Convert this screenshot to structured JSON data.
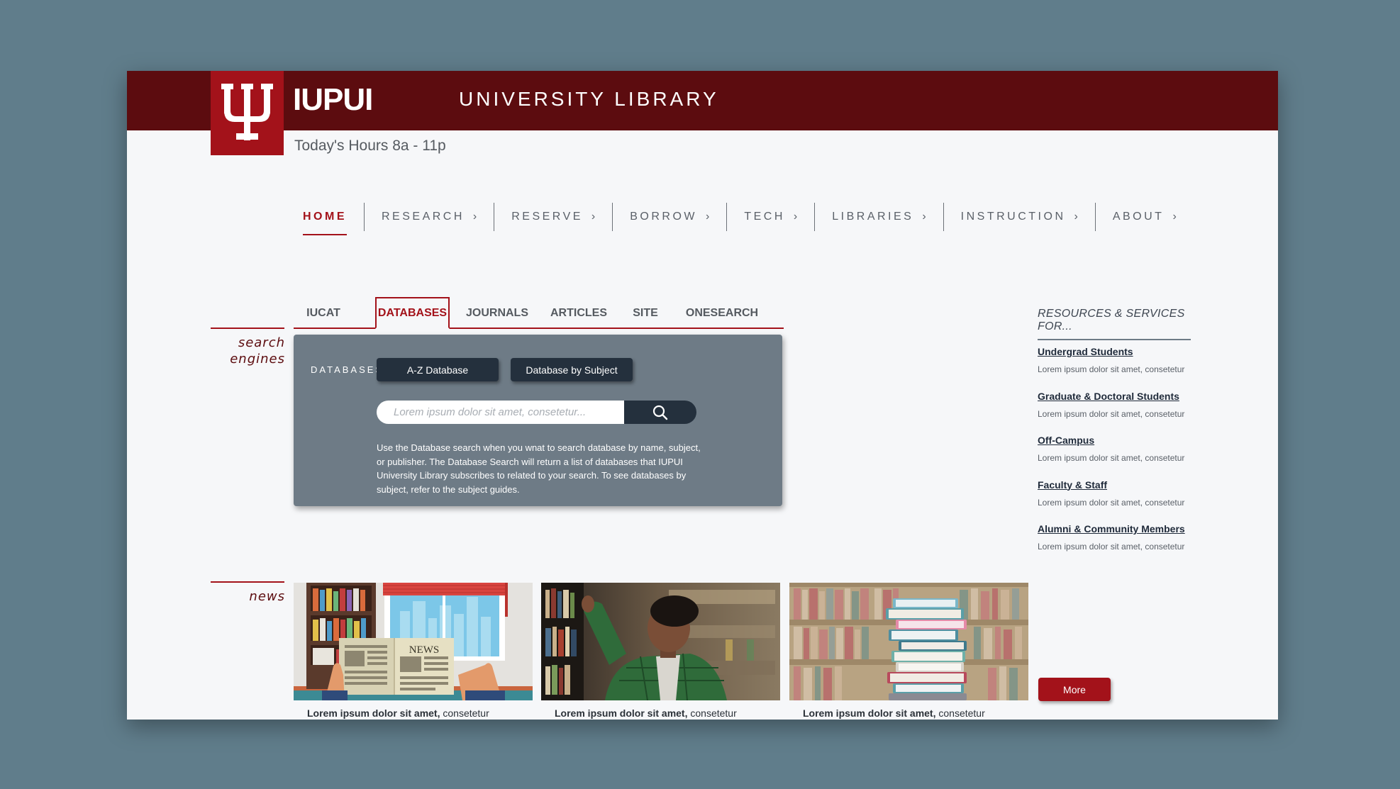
{
  "header": {
    "brand": "IUPUI",
    "unit_title": "UNIVERSITY LIBRARY",
    "hours": "Today's Hours 8a - 11p"
  },
  "main_nav": [
    {
      "label": "HOME",
      "active": true
    },
    {
      "label": "RESEARCH",
      "has_submenu": true
    },
    {
      "label": "RESERVE",
      "has_submenu": true
    },
    {
      "label": "BORROW",
      "has_submenu": true
    },
    {
      "label": "TECH",
      "has_submenu": true
    },
    {
      "label": "LIBRARIES",
      "has_submenu": true
    },
    {
      "label": "INSTRUCTION",
      "has_submenu": true
    },
    {
      "label": "ABOUT",
      "has_submenu": true
    }
  ],
  "search": {
    "section_label_line1": "search",
    "section_label_line2": "engines",
    "tabs": [
      {
        "label": "IUCAT"
      },
      {
        "label": "DATABASES",
        "active": true
      },
      {
        "label": "JOURNALS"
      },
      {
        "label": "ARTICLES"
      },
      {
        "label": "SITE"
      },
      {
        "label": "ONESEARCH"
      }
    ],
    "panel_label": "DATABASES",
    "az_button": "A-Z Database",
    "subject_button": "Database by Subject",
    "placeholder": "Lorem ipsum dolor sit amet, consetetur...",
    "description": "Use the Database search when you wnat to search database by name, subject, or publisher. The Database Search will return a list of databases that IUPUI University Library subscribes to related to your search. To see databases by subject, refer to the subject guides."
  },
  "resources": {
    "title": "RESOURCES & SERVICES FOR...",
    "items": [
      {
        "link": "Undergrad Students",
        "desc": "Lorem ipsum dolor sit amet, consetetur"
      },
      {
        "link": "Graduate & Doctoral Students",
        "desc": "Lorem ipsum dolor sit amet, consetetur"
      },
      {
        "link": "Off-Campus",
        "desc": "Lorem ipsum dolor sit amet, consetetur"
      },
      {
        "link": "Faculty & Staff",
        "desc": "Lorem ipsum dolor sit amet, consetetur"
      },
      {
        "link": "Alumni & Community Members",
        "desc": "Lorem ipsum dolor sit amet, consetetur"
      }
    ]
  },
  "news": {
    "section_label": "news",
    "items": [
      {
        "bold": "Lorem ipsum dolor sit amet,",
        "rest": " consetetur",
        "image_text": "NEWS"
      },
      {
        "bold": "Lorem ipsum dolor sit amet,",
        "rest": " consetetur"
      },
      {
        "bold": "Lorem ipsum dolor sit amet,",
        "rest": " consetetur"
      }
    ],
    "more_button": "More"
  },
  "colors": {
    "brand_dark": "#5c0c0f",
    "brand_red": "#a3121a",
    "panel": "#6e7b86",
    "button_dark": "#24303d",
    "backdrop": "#607d8b"
  }
}
